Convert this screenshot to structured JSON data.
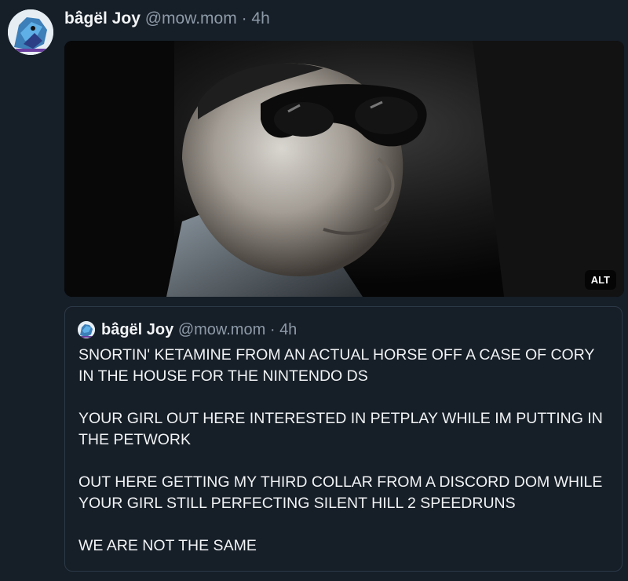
{
  "post": {
    "author_name": "bâ̈gël Joy",
    "handle": "@mow.mom",
    "separator": "·",
    "time": "4h",
    "media": {
      "alt_label": "ALT"
    }
  },
  "quote": {
    "author_name": "bâ̈gël Joy",
    "handle": "@mow.mom",
    "separator": "·",
    "time": "4h",
    "paragraphs": [
      "SNORTIN' KETAMINE FROM AN ACTUAL HORSE OFF A CASE OF CORY IN THE HOUSE FOR THE NINTENDO DS",
      "YOUR GIRL OUT HERE INTERESTED IN PETPLAY WHILE IM PUTTING IN THE PETWORK",
      "OUT HERE GETTING MY THIRD COLLAR FROM A DISCORD DOM WHILE YOUR GIRL STILL PERFECTING SILENT HILL 2 SPEEDRUNS",
      "WE ARE NOT THE SAME"
    ]
  }
}
